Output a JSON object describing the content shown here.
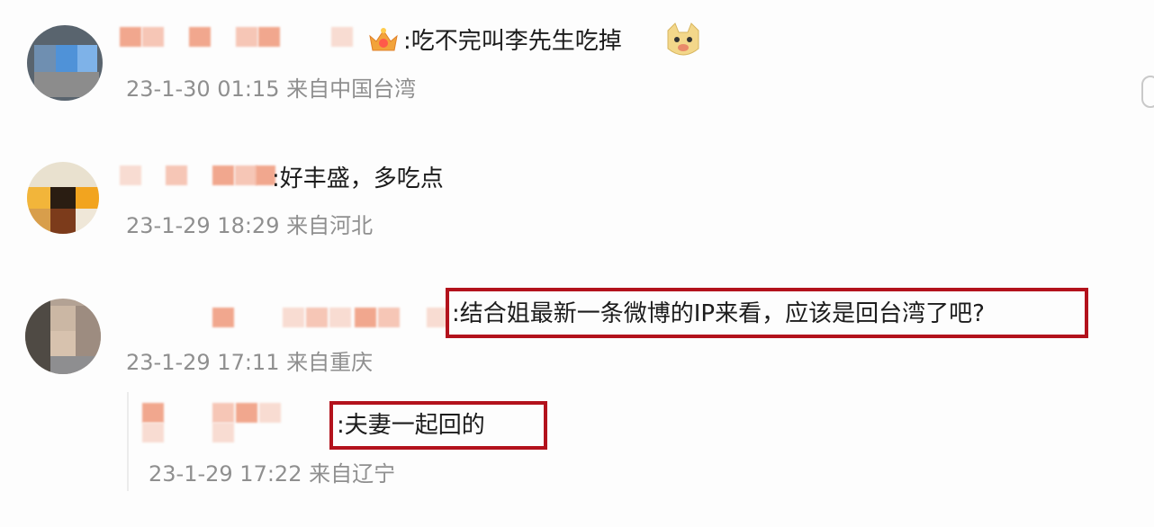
{
  "comments": [
    {
      "text": ":吃不完叫李先生吃掉",
      "meta": "23-1-30 01:15 来自中国台湾"
    },
    {
      "text": ":好丰盛，多吃点",
      "meta": "23-1-29 18:29 来自河北"
    },
    {
      "text": ":结合姐最新一条微博的IP来看，应该是回台湾了吧?",
      "meta": "23-1-29 17:11 来自重庆"
    }
  ],
  "reply": {
    "text": ":夫妻一起回的",
    "meta": "23-1-29 17:22 来自辽宁"
  },
  "colors": {
    "highlight": "#b3121c",
    "meta_text": "#8f8f8f",
    "blur_tone": "#f6c6b6"
  },
  "icons": [
    "vip-crown-icon",
    "doge-emoji-icon"
  ]
}
